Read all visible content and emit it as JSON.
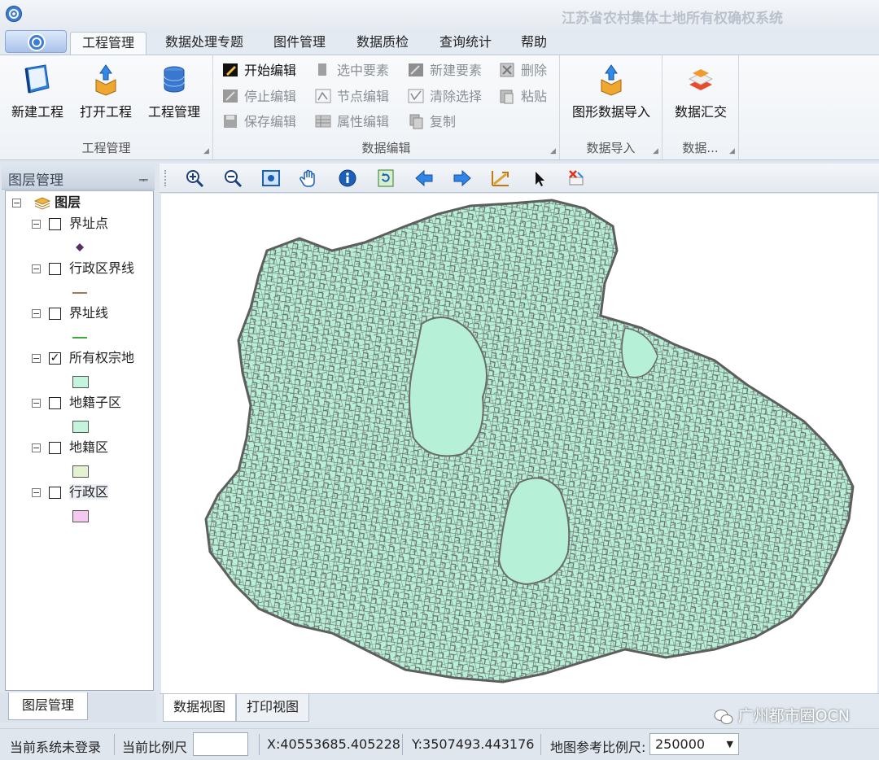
{
  "window": {
    "title": "江苏省农村集体土地所有权确权系统",
    "app_icon": "app-logo-icon"
  },
  "ribbon": {
    "tabs": [
      {
        "label": "工程管理",
        "active": true
      },
      {
        "label": "数据处理专题"
      },
      {
        "label": "图件管理"
      },
      {
        "label": "数据质检"
      },
      {
        "label": "查询统计"
      },
      {
        "label": "帮助"
      }
    ],
    "groups": {
      "project": {
        "label": "工程管理",
        "buttons": [
          {
            "label": "新建工程",
            "icon": "notebook-icon"
          },
          {
            "label": "打开工程",
            "icon": "box-open-icon"
          },
          {
            "label": "工程管理",
            "icon": "database-icon"
          }
        ]
      },
      "edit": {
        "label": "数据编辑",
        "buttons": [
          {
            "label": "开始编辑",
            "icon": "pencil-icon",
            "enabled": true
          },
          {
            "label": "停止编辑",
            "icon": "stop-edit-icon"
          },
          {
            "label": "保存编辑",
            "icon": "save-icon"
          },
          {
            "label": "选中要素",
            "icon": "select-feature-icon"
          },
          {
            "label": "节点编辑",
            "icon": "vertex-edit-icon"
          },
          {
            "label": "属性编辑",
            "icon": "attribute-table-icon"
          },
          {
            "label": "新建要素",
            "icon": "new-feature-icon"
          },
          {
            "label": "清除选择",
            "icon": "clear-selection-icon"
          },
          {
            "label": "复制",
            "icon": "copy-icon"
          },
          {
            "label": "删除",
            "icon": "delete-icon"
          },
          {
            "label": "粘贴",
            "icon": "paste-icon"
          }
        ]
      },
      "import": {
        "label": "数据导入",
        "buttons": [
          {
            "label": "图形数据导入",
            "icon": "import-box-icon"
          }
        ]
      },
      "submit": {
        "label": "数据...",
        "buttons": [
          {
            "label": "数据汇交",
            "icon": "data-submit-icon"
          }
        ]
      }
    }
  },
  "layer_panel": {
    "title": "图层管理",
    "tab_label": "图层管理",
    "root": {
      "label": "图层",
      "icon": "layers-icon"
    },
    "layers": [
      {
        "label": "界址点",
        "checked": false,
        "symbol": "point",
        "color": "#5b2d6e"
      },
      {
        "label": "行政区界线",
        "checked": false,
        "symbol": "line",
        "color": "#a0785a"
      },
      {
        "label": "界址线",
        "checked": false,
        "symbol": "line",
        "color": "#3caa3c"
      },
      {
        "label": "所有权宗地",
        "checked": true,
        "symbol": "fill",
        "color": "#c2f5dc"
      },
      {
        "label": "地籍子区",
        "checked": false,
        "symbol": "fill",
        "color": "#c2f5dc"
      },
      {
        "label": "地籍区",
        "checked": false,
        "symbol": "fill",
        "color": "#e3f2d0"
      },
      {
        "label": "行政区",
        "checked": false,
        "symbol": "fill",
        "color": "#f5c8f0"
      }
    ]
  },
  "map_toolbar": {
    "tools": [
      "zoom-in-icon",
      "zoom-out-icon",
      "full-extent-icon",
      "pan-hand-icon",
      "identify-info-icon",
      "refresh-icon",
      "back-arrow-icon",
      "forward-arrow-icon",
      "measure-icon",
      "select-pointer-icon",
      "clear-icon"
    ]
  },
  "map": {
    "parcel_fill": "#b6f0d6",
    "parcel_edge": "#6b6b6b"
  },
  "map_tabs": [
    {
      "label": "数据视图",
      "active": true
    },
    {
      "label": "打印视图"
    }
  ],
  "brand_watermark": {
    "text": "广州都市圈OCN",
    "icon": "wechat-icon"
  },
  "statusbar": {
    "login_status": "当前系统未登录",
    "current_scale_label": "当前比例尺",
    "current_scale_value": "",
    "x_coord": "X:40553685.405228",
    "y_coord": "Y:3507493.443176",
    "ref_scale_label": "地图参考比例尺:",
    "ref_scale_value": "250000"
  }
}
